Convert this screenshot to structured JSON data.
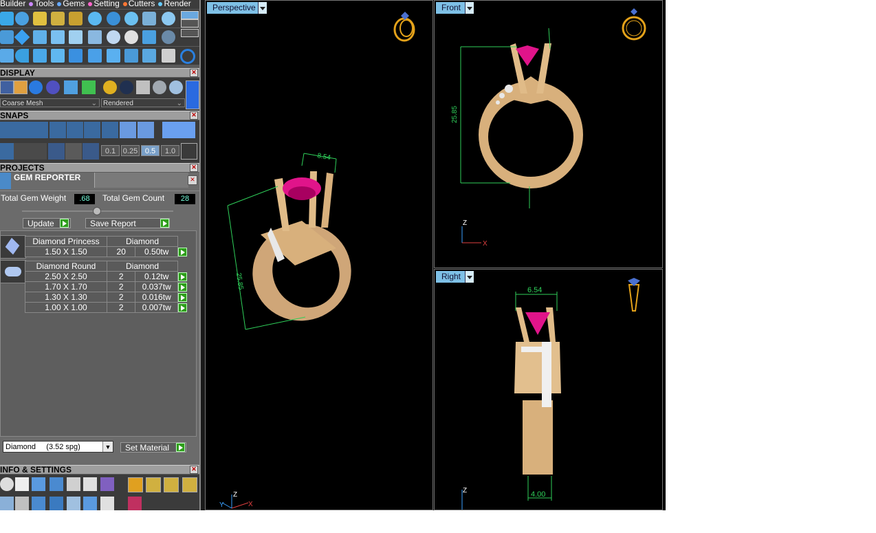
{
  "menu": {
    "items": [
      "Builder",
      "Tools",
      "Gems",
      "Setting",
      "Cutters",
      "Render"
    ]
  },
  "panels": {
    "display": {
      "title": "DISPLAY",
      "mesh": "Coarse Mesh",
      "render_mode": "Rendered"
    },
    "snaps": {
      "title": "SNAPS",
      "values": [
        "0.1",
        "0.25",
        "0.5",
        "1.0"
      ]
    },
    "projects": {
      "title": "PROJECTS"
    },
    "gem_reporter": {
      "title": "GEM REPORTER"
    },
    "info": {
      "title": "INFO & SETTINGS"
    }
  },
  "gem_report": {
    "total_weight_label": "Total Gem Weight",
    "total_weight": ".68",
    "total_count_label": "Total Gem Count",
    "total_count": "28",
    "update": "Update",
    "save_report": "Save Report",
    "groups": [
      {
        "name": "Diamond Princess",
        "material": "Diamond",
        "rows": [
          {
            "size": "1.50 X 1.50",
            "qty": "20",
            "tw": "0.50tw"
          }
        ]
      },
      {
        "name": "Diamond Round",
        "material": "Diamond",
        "rows": [
          {
            "size": "2.50 X 2.50",
            "qty": "2",
            "tw": "0.12tw"
          },
          {
            "size": "1.70 X 1.70",
            "qty": "2",
            "tw": "0.037tw"
          },
          {
            "size": "1.30 X 1.30",
            "qty": "2",
            "tw": "0.016tw"
          },
          {
            "size": "1.00 X 1.00",
            "qty": "2",
            "tw": "0.007tw"
          }
        ]
      }
    ],
    "material_select": "Diamond     (3.52 spg)",
    "set_material": "Set Material"
  },
  "viewports": {
    "perspective": {
      "label": "Perspective",
      "dim_width": "8.54",
      "dim_height": "25.85"
    },
    "front": {
      "label": "Front",
      "dim_height": "25.85"
    },
    "right": {
      "label": "Right",
      "dim_top": "6.54",
      "dim_bottom": "4.00"
    }
  },
  "axes": {
    "z": "Z",
    "x": "X",
    "y": "Y"
  },
  "colors": {
    "gold": "#d8b07c",
    "gem": "#e0148a",
    "dim": "#2fd05a",
    "tab": "#7ec0e6"
  }
}
